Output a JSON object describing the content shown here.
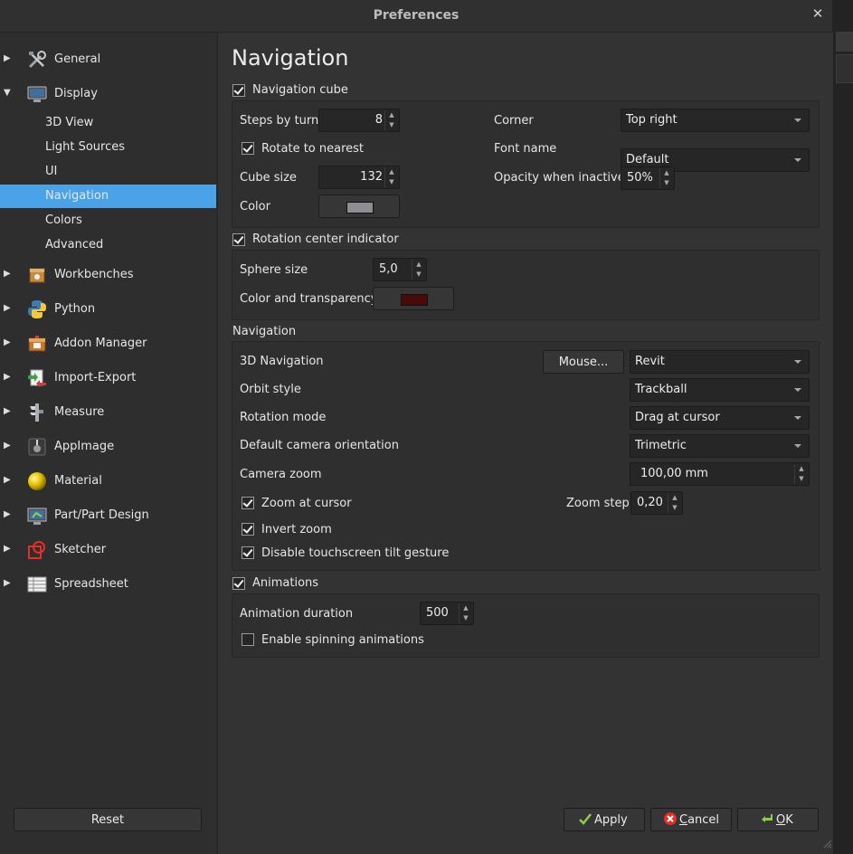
{
  "window": {
    "title": "Preferences",
    "close_glyph": "✕"
  },
  "sidebar": {
    "items": [
      {
        "label": "General",
        "icon": "tools-icon",
        "expanded": false
      },
      {
        "label": "Display",
        "icon": "monitor-icon",
        "expanded": true
      },
      {
        "label": "3D View",
        "sub": true
      },
      {
        "label": "Light Sources",
        "sub": true
      },
      {
        "label": "UI",
        "sub": true
      },
      {
        "label": "Navigation",
        "sub": true,
        "selected": true
      },
      {
        "label": "Colors",
        "sub": true
      },
      {
        "label": "Advanced",
        "sub": true
      },
      {
        "label": "Workbenches",
        "icon": "workbench-icon",
        "expanded": false
      },
      {
        "label": "Python",
        "icon": "python-icon",
        "expanded": false
      },
      {
        "label": "Addon Manager",
        "icon": "addon-manager-icon",
        "expanded": false
      },
      {
        "label": "Import-Export",
        "icon": "import-export-icon",
        "expanded": false
      },
      {
        "label": "Measure",
        "icon": "caliper-icon",
        "expanded": false
      },
      {
        "label": "AppImage",
        "icon": "appimage-icon",
        "expanded": false
      },
      {
        "label": "Material",
        "icon": "material-sphere-icon",
        "expanded": false
      },
      {
        "label": "Part/Part Design",
        "icon": "part-design-icon",
        "expanded": false
      },
      {
        "label": "Sketcher",
        "icon": "sketcher-icon",
        "expanded": false
      },
      {
        "label": "Spreadsheet",
        "icon": "spreadsheet-icon",
        "expanded": false
      }
    ],
    "reset_label": "Reset"
  },
  "page": {
    "heading": "Navigation",
    "navcube": {
      "label": "Navigation cube",
      "checked": true,
      "steps_label": "Steps by turn",
      "steps_value": "8",
      "rotate_label": "Rotate to nearest",
      "rotate_checked": true,
      "cube_size_label": "Cube size",
      "cube_size_value": "132",
      "color_label": "Color",
      "color_value": "#8e8e92",
      "corner_label": "Corner",
      "corner_value": "Top right",
      "font_label": "Font name",
      "font_value": "Default",
      "opacity_label": "Opacity when inactive",
      "opacity_value": "50%"
    },
    "rotcenter": {
      "label": "Rotation center indicator",
      "checked": true,
      "sphere_label": "Sphere size",
      "sphere_value": "5,0",
      "color_label": "Color and transparency",
      "color_value": "#4a0a0a"
    },
    "navigation": {
      "group_title": "Navigation",
      "nav3d_label": "3D Navigation",
      "mouse_button": "Mouse...",
      "nav3d_value": "Revit",
      "orbit_label": "Orbit style",
      "orbit_value": "Trackball",
      "rotmode_label": "Rotation mode",
      "rotmode_value": "Drag at cursor",
      "camera_label": "Default camera orientation",
      "camera_value": "Trimetric",
      "zoom_label": "Camera zoom",
      "zoom_value": "100,00 mm",
      "zoom_cursor_label": "Zoom at cursor",
      "zoom_cursor_checked": true,
      "zoom_step_label": "Zoom step",
      "zoom_step_value": "0,20",
      "invert_label": "Invert zoom",
      "invert_checked": true,
      "tilt_label": "Disable touchscreen tilt gesture",
      "tilt_checked": true
    },
    "animations": {
      "label": "Animations",
      "checked": true,
      "duration_label": "Animation duration",
      "duration_value": "500",
      "spin_label": "Enable spinning animations",
      "spin_checked": false
    }
  },
  "footer": {
    "apply_label": "Apply",
    "cancel_prefix": "C",
    "cancel_rest": "ancel",
    "ok_prefix": "O",
    "ok_rest": "K"
  },
  "colors": {
    "selection": "#4aa3e8",
    "background": "#333333"
  }
}
